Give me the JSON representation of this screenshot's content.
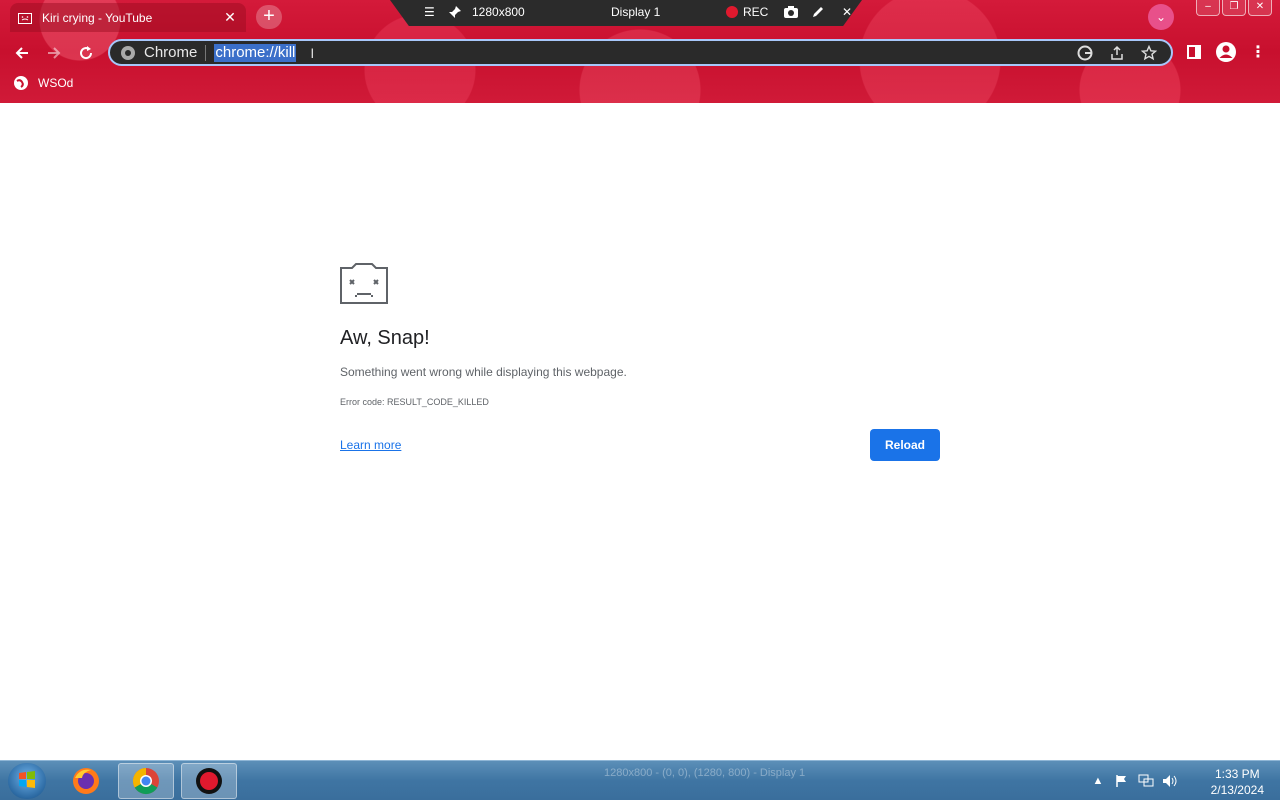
{
  "tab": {
    "title": "Kiri crying - YouTube",
    "close": "✕"
  },
  "new_tab": "+",
  "recorder": {
    "resolution": "1280x800",
    "display": "Display 1",
    "rec_label": "REC"
  },
  "omnibox": {
    "site_chip": "Chrome",
    "url": "chrome://kill"
  },
  "bookmarks": [
    {
      "label": "WSOd"
    }
  ],
  "page": {
    "heading": "Aw, Snap!",
    "message": "Something went wrong while displaying this webpage.",
    "error_code": "Error code: RESULT_CODE_KILLED",
    "learn_more": "Learn more",
    "reload": "Reload"
  },
  "taskbar": {
    "ghost_label": "1280x800 - (0, 0), (1280, 800) - Display 1",
    "time": "1:33 PM",
    "date": "2/13/2024"
  },
  "colors": {
    "accent": "#1a73e8",
    "chrome_red": "#c8102e",
    "omnibox_bg": "#2a2a2a"
  }
}
